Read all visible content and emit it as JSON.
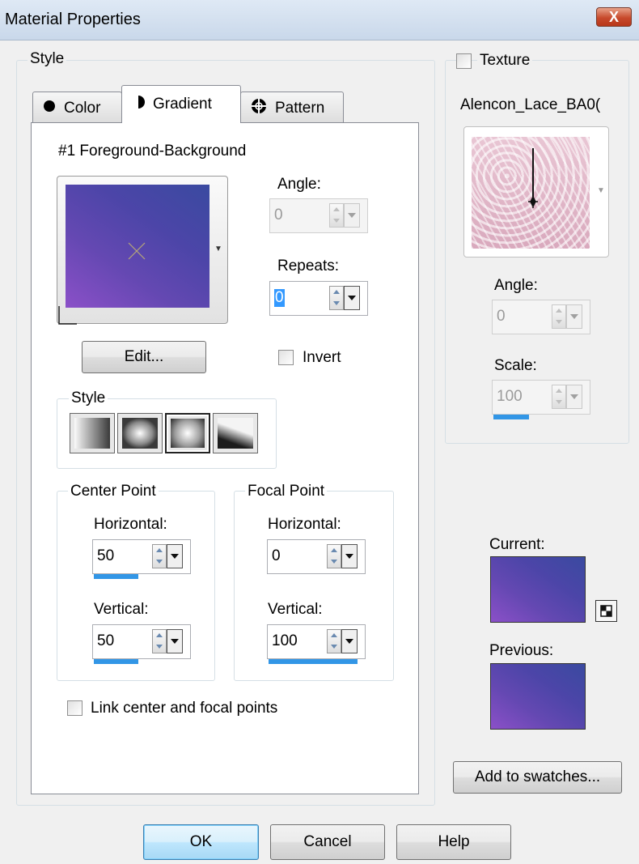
{
  "window": {
    "title": "Material Properties",
    "close_label": "X"
  },
  "style_group": {
    "label": "Style"
  },
  "tabs": [
    {
      "label": "Color",
      "icon": "filled-circle-icon",
      "active": false
    },
    {
      "label": "Gradient",
      "icon": "half-circle-icon",
      "active": true
    },
    {
      "label": "Pattern",
      "icon": "pattern-globe-icon",
      "active": false
    }
  ],
  "gradient": {
    "name": "#1 Foreground-Background",
    "colors": [
      "#8b50c8",
      "#3a4aa0"
    ],
    "edit_label": "Edit...",
    "angle": {
      "label": "Angle:",
      "value": "0",
      "enabled": false
    },
    "repeats": {
      "label": "Repeats:",
      "value": "0",
      "enabled": true
    },
    "invert": {
      "label": "Invert",
      "checked": false
    },
    "style": {
      "label": "Style",
      "options": [
        "linear",
        "rectangular",
        "sunburst",
        "radial"
      ],
      "selected": "sunburst"
    },
    "center_point": {
      "label": "Center Point",
      "horizontal": {
        "label": "Horizontal:",
        "value": "50",
        "fraction": 0.5
      },
      "vertical": {
        "label": "Vertical:",
        "value": "50",
        "fraction": 0.5
      }
    },
    "focal_point": {
      "label": "Focal Point",
      "horizontal": {
        "label": "Horizontal:",
        "value": "0",
        "fraction": 0
      },
      "vertical": {
        "label": "Vertical:",
        "value": "100",
        "fraction": 1.0
      }
    },
    "link_points": {
      "label": "Link center and focal points",
      "checked": false
    }
  },
  "texture": {
    "label": "Texture",
    "checked": false,
    "name": "Alencon_Lace_BA0(",
    "angle": {
      "label": "Angle:",
      "value": "0",
      "enabled": false
    },
    "scale": {
      "label": "Scale:",
      "value": "100",
      "enabled": false,
      "fraction": 0.4
    }
  },
  "current": {
    "label": "Current:"
  },
  "previous": {
    "label": "Previous:"
  },
  "add_swatches_label": "Add to swatches...",
  "footer": {
    "ok_label": "OK",
    "cancel_label": "Cancel",
    "help_label": "Help"
  }
}
